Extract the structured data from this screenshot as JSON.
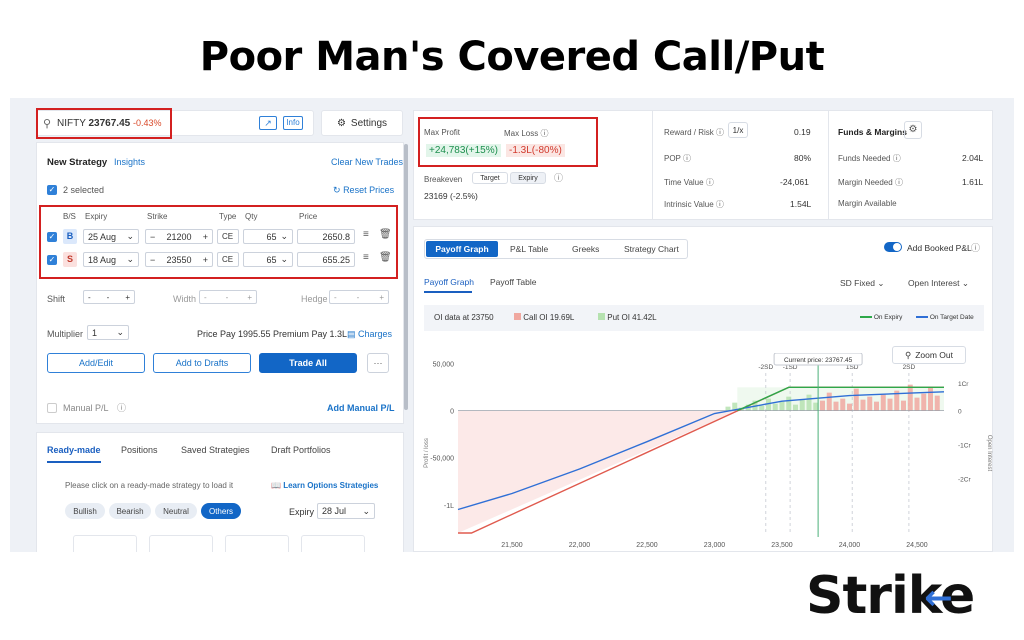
{
  "page_title": "Poor Man's Covered Call/Put",
  "header": {
    "search_text": "NIFTY",
    "price": "23767.45",
    "change": "-0.43%",
    "info_label": "Info",
    "settings_label": "Settings"
  },
  "strategy": {
    "title": "New Strategy",
    "insights_label": "Insights",
    "clear_label": "Clear New Trades",
    "selected_label": "2 selected",
    "reset_label": "Reset Prices",
    "columns": [
      "B/S",
      "Expiry",
      "Strike",
      "Type",
      "Qty",
      "Price"
    ],
    "legs": [
      {
        "side": "B",
        "expiry": "25 Aug",
        "strike": "21200",
        "type": "CE",
        "qty": "65",
        "price": "2650.8"
      },
      {
        "side": "S",
        "expiry": "18 Aug",
        "strike": "23550",
        "type": "CE",
        "qty": "65",
        "price": "655.25"
      }
    ],
    "shift_label": "Shift",
    "width_label": "Width",
    "hedge_label": "Hedge",
    "dash": "-",
    "multiplier_label": "Multiplier",
    "multiplier_value": "1",
    "price_pay": "Price Pay 1995.55",
    "premium_pay": "Premium Pay 1.3L",
    "charges_label": "Charges",
    "add_edit": "Add/Edit",
    "add_drafts": "Add to Drafts",
    "trade_all": "Trade All",
    "more": "···",
    "manual_pl": "Manual P/L",
    "add_manual_pl": "Add Manual P/L"
  },
  "bottom_tabs": {
    "tabs": [
      "Ready-made",
      "Positions",
      "Saved Strategies",
      "Draft Portfolios"
    ],
    "hint": "Please click on a ready-made strategy to load it",
    "learn_label": "Learn Options Strategies",
    "filters": [
      "Bullish",
      "Bearish",
      "Neutral",
      "Others"
    ],
    "expiry_label": "Expiry",
    "expiry_value": "28 Jul"
  },
  "metrics": {
    "max_profit_label": "Max Profit",
    "max_profit_value": "+24,783(+15%)",
    "max_loss_label": "Max Loss",
    "max_loss_value": "-1.3L(-80%)",
    "breakeven_label": "Breakeven",
    "target_label": "Target",
    "expiry_label": "Expiry",
    "breakeven_value": "23169 (-2.5%)",
    "reward_risk_label": "Reward / Risk",
    "reward_risk_btn": "1/x",
    "reward_risk_value": "0.19",
    "pop_label": "POP",
    "pop_value": "80%",
    "time_value_label": "Time Value",
    "time_value_value": "-24,061",
    "intrinsic_label": "Intrinsic Value",
    "intrinsic_value": "1.54L",
    "funds_title": "Funds & Margins",
    "funds_needed_label": "Funds Needed",
    "funds_needed_value": "2.04L",
    "margin_needed_label": "Margin Needed",
    "margin_needed_value": "1.61L",
    "margin_available_label": "Margin Available"
  },
  "graph_panel": {
    "tabs": [
      "Payoff Graph",
      "P&L Table",
      "Greeks",
      "Strategy Chart"
    ],
    "add_booked": "Add Booked P&L",
    "subtabs": [
      "Payoff Graph",
      "Payoff Table"
    ],
    "sd_fixed": "SD Fixed",
    "open_interest": "Open Interest",
    "oi_label": "OI data at 23750",
    "call_oi": "Call OI 19.69L",
    "put_oi": "Put OI 41.42L",
    "on_expiry": "On Expiry",
    "on_target": "On Target Date",
    "current_price": "Current price: 23767.45",
    "zoom_out": "Zoom Out"
  },
  "chart_data": {
    "type": "line",
    "xlim": [
      21100,
      24700
    ],
    "ylim": [
      -130000,
      40000
    ],
    "x_ticks": [
      "21,500",
      "22,000",
      "22,500",
      "23,000",
      "23,500",
      "24,000",
      "24,500"
    ],
    "y_ticks": [
      "50,000",
      "0",
      "-50,000",
      "-1L"
    ],
    "y_right_ticks": [
      "1Cr",
      "0",
      "-1Cr",
      "-2Cr"
    ],
    "sd_labels": [
      "-2SD",
      "-1SD",
      "1SD",
      "2SD"
    ],
    "ylabel": "Profit / loss",
    "ylabel_right": "Open Interest",
    "series": [
      {
        "name": "On Expiry",
        "color": "#e05a4e",
        "x": [
          21100,
          21200,
          23550,
          24700
        ],
        "y": [
          -130000,
          -130000,
          24783,
          24783
        ]
      },
      {
        "name": "On Target Date",
        "color": "#2f6fd6",
        "x": [
          21100,
          21500,
          22000,
          22500,
          23000,
          23500,
          24000,
          24500,
          24700
        ],
        "y": [
          -105000,
          -88000,
          -62000,
          -33000,
          -3000,
          10000,
          16000,
          19000,
          20000
        ]
      }
    ],
    "current_price": 23767.45
  }
}
